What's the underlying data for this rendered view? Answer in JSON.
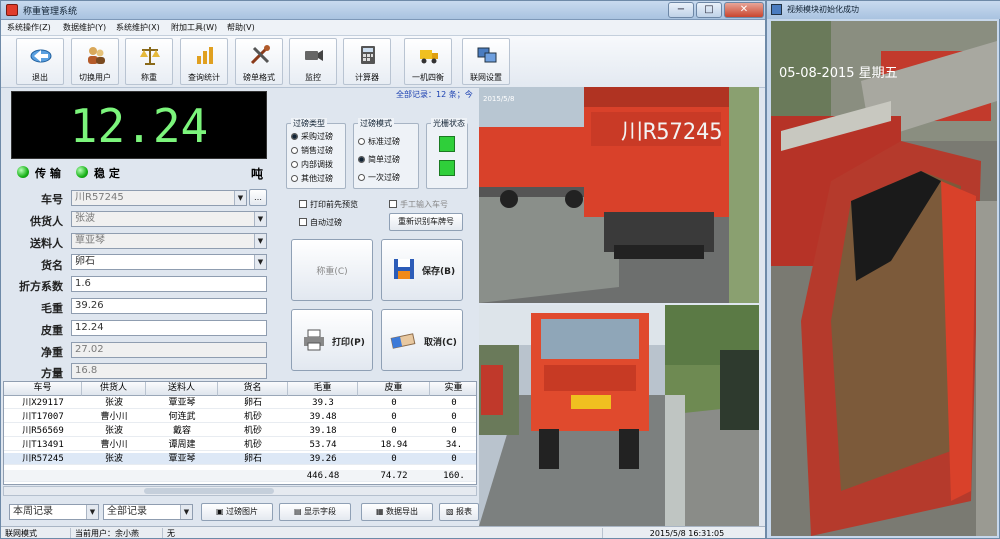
{
  "window": {
    "title": "称重管理系统",
    "min": "−",
    "max": "□",
    "close": "✕"
  },
  "menu": [
    "系统操作(Z)",
    "数据维护(Y)",
    "系统维护(X)",
    "附加工具(W)",
    "帮助(V)"
  ],
  "toolbar": [
    {
      "label": "退出",
      "icon": "exit-icon"
    },
    {
      "label": "切换用户",
      "icon": "switch-user-icon"
    },
    {
      "label": "称重",
      "icon": "scale-icon"
    },
    {
      "label": "查询统计",
      "icon": "statistics-icon"
    },
    {
      "label": "磅单格式",
      "icon": "tools-icon"
    },
    {
      "label": "监控",
      "icon": "camera-icon"
    },
    {
      "label": "计算器",
      "icon": "calculator-icon"
    },
    {
      "label": "一机四衡",
      "icon": "truck-icon"
    },
    {
      "label": "联网设置",
      "icon": "network-icon"
    }
  ],
  "weight_display": "12.24",
  "unit": "吨",
  "status": {
    "transmit": "传 输",
    "stable": "稳 定"
  },
  "record_info": "全部记录：12 条；今",
  "form": {
    "fields": [
      {
        "label": "车号",
        "value": "川R57245"
      },
      {
        "label": "供货人",
        "value": "张波"
      },
      {
        "label": "送料人",
        "value": "覃亚琴"
      },
      {
        "label": "货名",
        "value": "卵石"
      },
      {
        "label": "折方系数",
        "value": "1.6"
      },
      {
        "label": "毛重",
        "value": "39.26"
      },
      {
        "label": "皮重",
        "value": "12.24"
      },
      {
        "label": "净重",
        "value": "27.02"
      },
      {
        "label": "方量",
        "value": "16.8"
      }
    ],
    "more": "…"
  },
  "weigh_type": {
    "title": "过磅类型",
    "options": [
      "采购过磅",
      "销售过磅",
      "内部调拨",
      "其他过磅"
    ],
    "selected": 0
  },
  "weigh_mode": {
    "title": "过磅模式",
    "options": [
      "标准过磅",
      "简单过磅",
      "一次过磅"
    ],
    "selected": 1
  },
  "light_status": {
    "title": "光栅状态"
  },
  "checkbox_print_preview": "打印前先预览",
  "checkbox_manual_plate": "手工输入车号",
  "checkbox_auto_weigh": "自动过磅",
  "button_recognize": "重新识别车牌号",
  "button_weigh": "称重(C)",
  "button_save": "保存(B)",
  "button_print": "打印(P)",
  "button_cancel": "取消(C)",
  "table": {
    "headers": [
      "车号",
      "供货人",
      "送料人",
      "货名",
      "毛重",
      "皮重",
      "实重"
    ],
    "rows": [
      [
        "川X29117",
        "张波",
        "覃亚琴",
        "卵石",
        "39.3",
        "0",
        "0"
      ],
      [
        "川T17007",
        "曹小川",
        "何连武",
        "机砂",
        "39.48",
        "0",
        "0"
      ],
      [
        "川R56569",
        "张波",
        "戴容",
        "机砂",
        "39.18",
        "0",
        "0"
      ],
      [
        "川T13491",
        "曹小川",
        "谭周建",
        "机砂",
        "53.74",
        "18.94",
        "34."
      ],
      [
        "川R57245",
        "张波",
        "覃亚琴",
        "卵石",
        "39.26",
        "0",
        "0"
      ]
    ],
    "totals": [
      "446.48",
      "74.72",
      "160."
    ]
  },
  "bottom": {
    "filter_time": "本周记录",
    "filter_all": "全部记录",
    "btn_photo": "过磅图片",
    "btn_font": "显示字段",
    "btn_export": "数据导出",
    "btn_report": "报表"
  },
  "statusbar": {
    "mode": "联网模式",
    "operator": "当前用户：余小燕",
    "extra": "无",
    "datetime": "2015/5/8 16:31:05"
  },
  "cameras": {
    "cam1_plate": "川R57245",
    "cam1_time": "2015/5/8",
    "cam4_time": "05-08-2015 星期五"
  },
  "right_window": {
    "title": "视频模块初始化成功"
  },
  "colors": {
    "display_bg": "#000000",
    "display_fg": "#7cf57c",
    "led": "#19b319",
    "truck": "#d9412a"
  }
}
